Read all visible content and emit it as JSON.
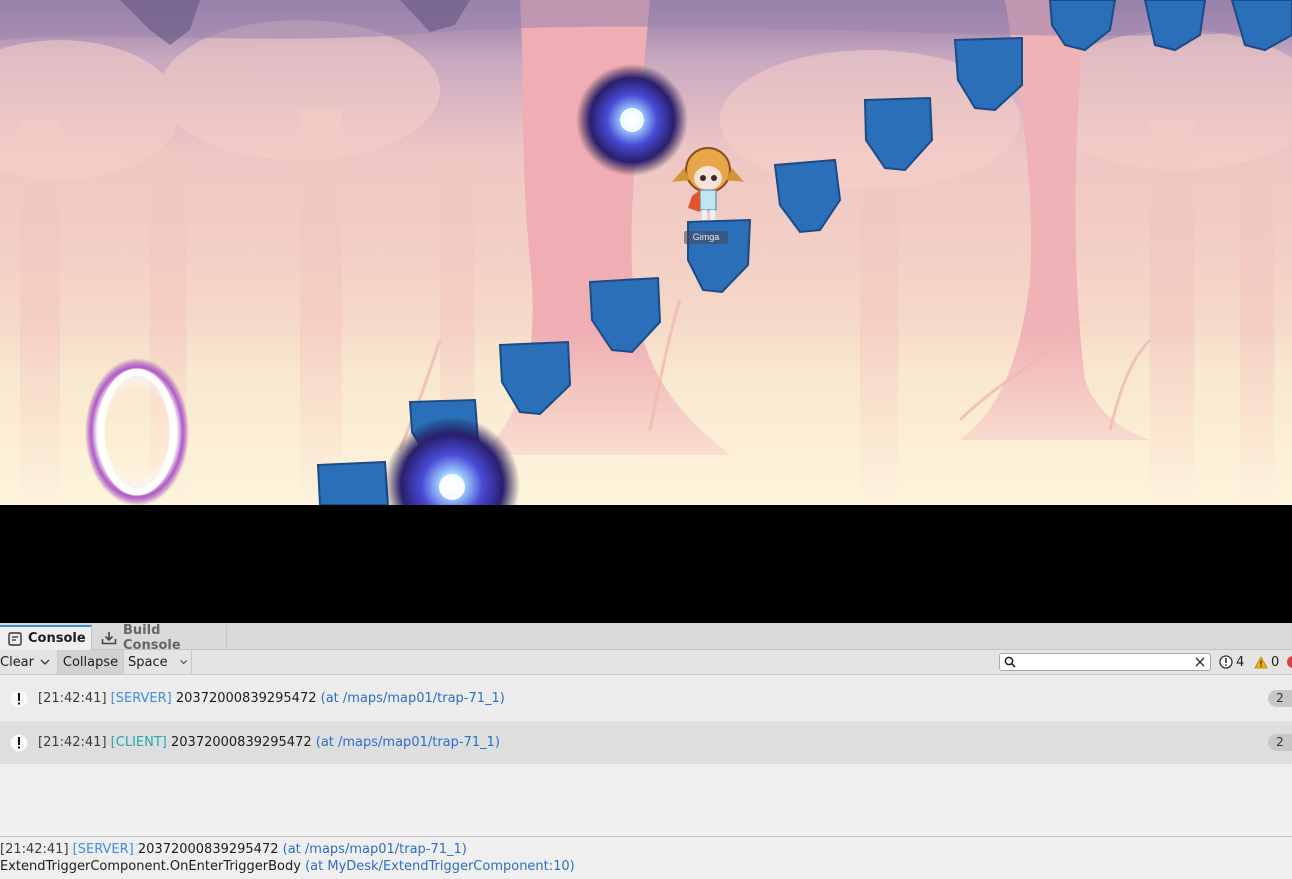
{
  "game": {
    "character_name": "Gimga"
  },
  "console": {
    "tabs": [
      {
        "label": "Console",
        "icon": "console-icon",
        "active": true
      },
      {
        "label": "Build Console",
        "icon": "download-icon",
        "active": false
      }
    ],
    "toolbar": {
      "clear_label": "Clear",
      "collapse_label": "Collapse",
      "space_label": "Space",
      "search_value": "",
      "error_count": "4",
      "warning_count": "0"
    },
    "entries": [
      {
        "time": "[21:42:41]",
        "tag": "[SERVER]",
        "message": "20372000839295472",
        "location": "(at /maps/map01/trap-71_1)",
        "count": "2"
      },
      {
        "time": "[21:42:41]",
        "tag": "[CLIENT]",
        "message": "20372000839295472",
        "location": "(at /maps/map01/trap-71_1)",
        "count": "2"
      }
    ],
    "detail": {
      "line1_time": "[21:42:41]",
      "line1_tag": "[SERVER]",
      "line1_message": "20372000839295472",
      "line1_location": "(at /maps/map01/trap-71_1)",
      "line2_call": "ExtendTriggerComponent.OnEnterTriggerBody",
      "line2_location": "(at MyDesk/ExtendTriggerComponent:10)"
    },
    "colors": {
      "accent": "#3b8de0",
      "server_tag": "#3d8ee0",
      "client_tag": "#25a7a6",
      "location_link": "#2b6fc9",
      "warning": "#f2b600"
    }
  }
}
